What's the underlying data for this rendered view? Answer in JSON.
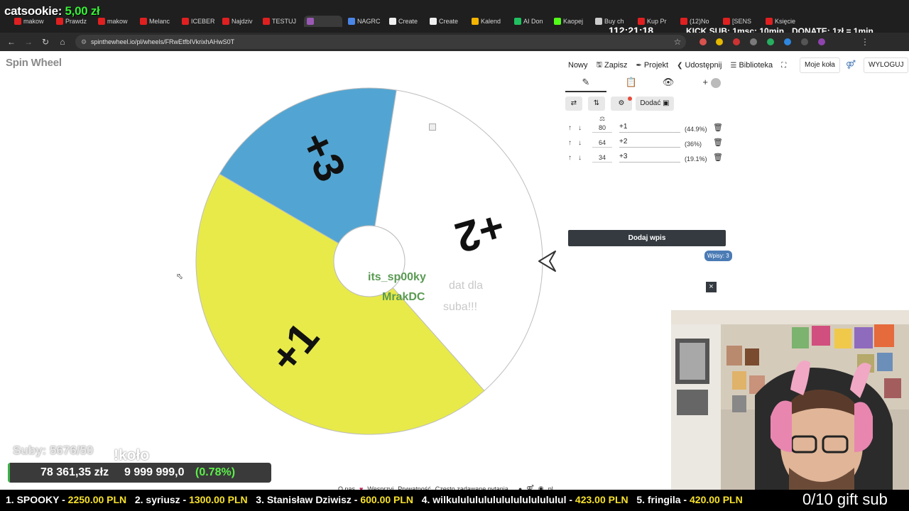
{
  "stream": {
    "catsookie_label": "catsookie:",
    "catsookie_value": "5,00 zł",
    "timer": "112:21:18",
    "kick_sub": "KICK SUB: 1msc: 10min",
    "donate": "DONATE: 1zł = 1min",
    "subs_line": "Suby: 5676/50",
    "kolo": "!koło",
    "bar_amount": "78 361,35 złz",
    "bar_goal": "9 999 999,0",
    "bar_percent_text": "(0.78%)",
    "bar_fill_fraction": 0.0078,
    "gift_sub": "0/10 gift sub",
    "ticker": [
      {
        "name": "1. SPOOKY - ",
        "value": "2250.00 PLN"
      },
      {
        "name": "2. syriusz - ",
        "value": "1300.00 PLN"
      },
      {
        "name": "3. Stanisław Dziwisz - ",
        "value": "600.00 PLN"
      },
      {
        "name": "4. wilkululululululululululululul - ",
        "value": "423.00 PLN"
      },
      {
        "name": "5. fringila - ",
        "value": "420.00 PLN"
      }
    ],
    "chat": {
      "user1": "its_sp00ky",
      "msg1": "dat dla",
      "user2": "MrakDC",
      "msg2": "suba!!!"
    }
  },
  "browser": {
    "tabs": [
      {
        "label": "makow",
        "color": "#e02020"
      },
      {
        "label": "Prawdz",
        "color": "#e02020"
      },
      {
        "label": "makow",
        "color": "#e02020"
      },
      {
        "label": "Melanc",
        "color": "#e02020"
      },
      {
        "label": "ICEBER",
        "color": "#e02020"
      },
      {
        "label": "Najdziv",
        "color": "#e02020"
      },
      {
        "label": "TESTUJ",
        "color": "#e02020"
      },
      {
        "label": "",
        "color": "#9b59b6"
      },
      {
        "label": "NAGRC",
        "color": "#4a86e8"
      },
      {
        "label": "Create",
        "color": "#f0f0f0"
      },
      {
        "label": "Create",
        "color": "#f0f0f0"
      },
      {
        "label": "Kalend",
        "color": "#f4b400"
      },
      {
        "label": "AI Don",
        "color": "#20c060"
      },
      {
        "label": "Kaopej",
        "color": "#53fc18"
      },
      {
        "label": "Buy ch",
        "color": "#cccccc"
      },
      {
        "label": "Kup Pr",
        "color": "#e02020"
      },
      {
        "label": "(12)No",
        "color": "#e02020"
      },
      {
        "label": "[SENS",
        "color": "#e02020"
      },
      {
        "label": "Księcie",
        "color": "#e02020"
      }
    ],
    "url": "spinthewheel.io/pl/wheels/FRwEtfbIVkrixhAHwS0T"
  },
  "app": {
    "logo": "Spin Wheel",
    "menu": {
      "new": "Nowy",
      "save": "Zapisz",
      "project": "Projekt",
      "share": "Udostępnij",
      "library": "Biblioteka",
      "my_wheels": "Moje koła",
      "logout": "WYLOGUJ"
    },
    "tools": {
      "add": "Dodać"
    },
    "entries": [
      {
        "weight": "80",
        "name": "+1",
        "percent": "(44.9%)"
      },
      {
        "weight": "64",
        "name": "+2",
        "percent": "(36%)"
      },
      {
        "weight": "34",
        "name": "+3",
        "percent": "(19.1%)"
      }
    ],
    "add_entry": "Dodaj wpis",
    "entries_badge": "Wpisy: 3",
    "footer": {
      "about": "O nas",
      "support": "Wesprzyj",
      "privacy": "Prywatność",
      "faq": "Często zadawane pytania",
      "lang": "pl"
    }
  },
  "chart_data": {
    "type": "pie",
    "categories": [
      "+1",
      "+2",
      "+3"
    ],
    "values": [
      80,
      64,
      34
    ],
    "colors": [
      "#e8ea4a",
      "#ffffff",
      "#52a5d2"
    ],
    "title": ""
  }
}
